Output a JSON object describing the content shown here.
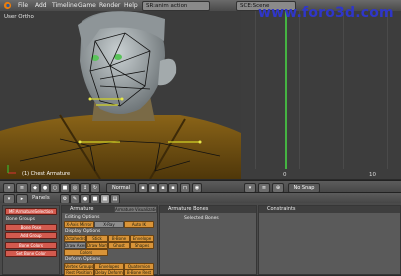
{
  "menu": {
    "items": [
      "File",
      "Add",
      "Timeline",
      "Game",
      "Render",
      "Help"
    ],
    "screen_name": "SR:anim action",
    "scene_name": "SCE:Scene"
  },
  "watermark": "www.foro3d.com",
  "viewport": {
    "view_label": "User Ortho",
    "status": "(1) Chest Armature"
  },
  "viewport_header": {
    "mode": "Pose Mode",
    "shading": "Normal"
  },
  "timeline": {
    "ticks": [
      "0",
      "10"
    ],
    "snap": "No Snap"
  },
  "buttons_header": {
    "label": "Panels"
  },
  "buttons_window": {
    "left_panel": {
      "fields": [
        "MF:ArmatureSelection",
        "Bone Groups",
        "Bone Pose",
        "Add Group",
        "Bone Colors",
        "Set Bone Color"
      ]
    },
    "armature_panel": {
      "header": "Armature",
      "tab": "Armature Visualizations",
      "editing_label": "Editing Options",
      "editing_buttons": [
        "X-Axis Mirror",
        "X-Ray",
        "Auto IK"
      ],
      "display_label": "Display Options",
      "display_buttons": [
        "Octahedron",
        "Stick",
        "B-Bone",
        "Envelope",
        "Draw Axes",
        "Draw Names",
        "Ghost",
        "Shapes",
        "Colors"
      ],
      "deform_label": "Deform Options",
      "deform_buttons": [
        "Vertex Groups",
        "Envelopes",
        "Quaternion",
        "Rest Position",
        "Delay Deform",
        "B-Bone Rest"
      ]
    },
    "armature_bones_panel": {
      "header": "Armature Bones",
      "label": "Selected Bones"
    },
    "constraints_panel": {
      "header": "Constraints"
    }
  },
  "colors": {
    "accent_orange": "#d99438",
    "timeline_cursor": "#45b342",
    "watermark": "#2f36c9"
  }
}
